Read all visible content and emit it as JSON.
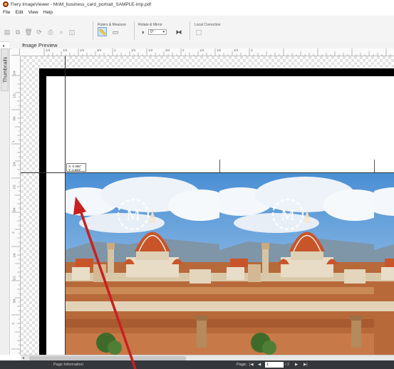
{
  "window": {
    "title": "Fiery ImageViewer - MnM_business_card_portrait_SAMPLE-imp.pdf",
    "icon": "fiery-logo-icon"
  },
  "menu": [
    "File",
    "Edit",
    "View",
    "Help"
  ],
  "toolbar": {
    "groups": [
      {
        "label": "Rulers & Measure"
      },
      {
        "label": "Rotate & Mirror"
      },
      {
        "label": "Local Correction"
      }
    ],
    "rotate_value": "0°",
    "icons": [
      "save-icon",
      "copy-icon",
      "delete-icon",
      "refresh-icon",
      "print-icon",
      "zoom-icon",
      "compare-icon",
      "rulers-icon",
      "measure-icon",
      "rotate-icon",
      "mirror-icon",
      "local-correction-icon"
    ]
  },
  "panel": {
    "title": "Image Preview",
    "sidebar_tab": "Thumbnails"
  },
  "rulers": {
    "top_labels": [
      "1/4",
      "1/4",
      "1/2",
      "3/4",
      "1",
      "1/4",
      "1/2",
      "3/4",
      "2",
      "1/4",
      "1/2",
      "3/4",
      "3"
    ],
    "left_labels": [
      "1/4",
      "1/2",
      "3/4",
      "1",
      "1/4",
      "1/2",
      "3/4",
      "2",
      "1/4",
      "1/2",
      "3/4",
      "3"
    ]
  },
  "canvas": {
    "coord_x": "X: 0.386\"",
    "coord_y": "Y: 1.501\"",
    "monogram": "M"
  },
  "statusbar": {
    "info": "Page Information",
    "page_label": "Page:",
    "first": "|◀",
    "prev": "◀",
    "current_page": "1",
    "total": "/ 2",
    "next": "▶",
    "last": "▶|"
  },
  "colors": {
    "statusbar": "#34383c",
    "pointer_arrow": "#c8201e",
    "highlight": "#cfe3f7"
  }
}
